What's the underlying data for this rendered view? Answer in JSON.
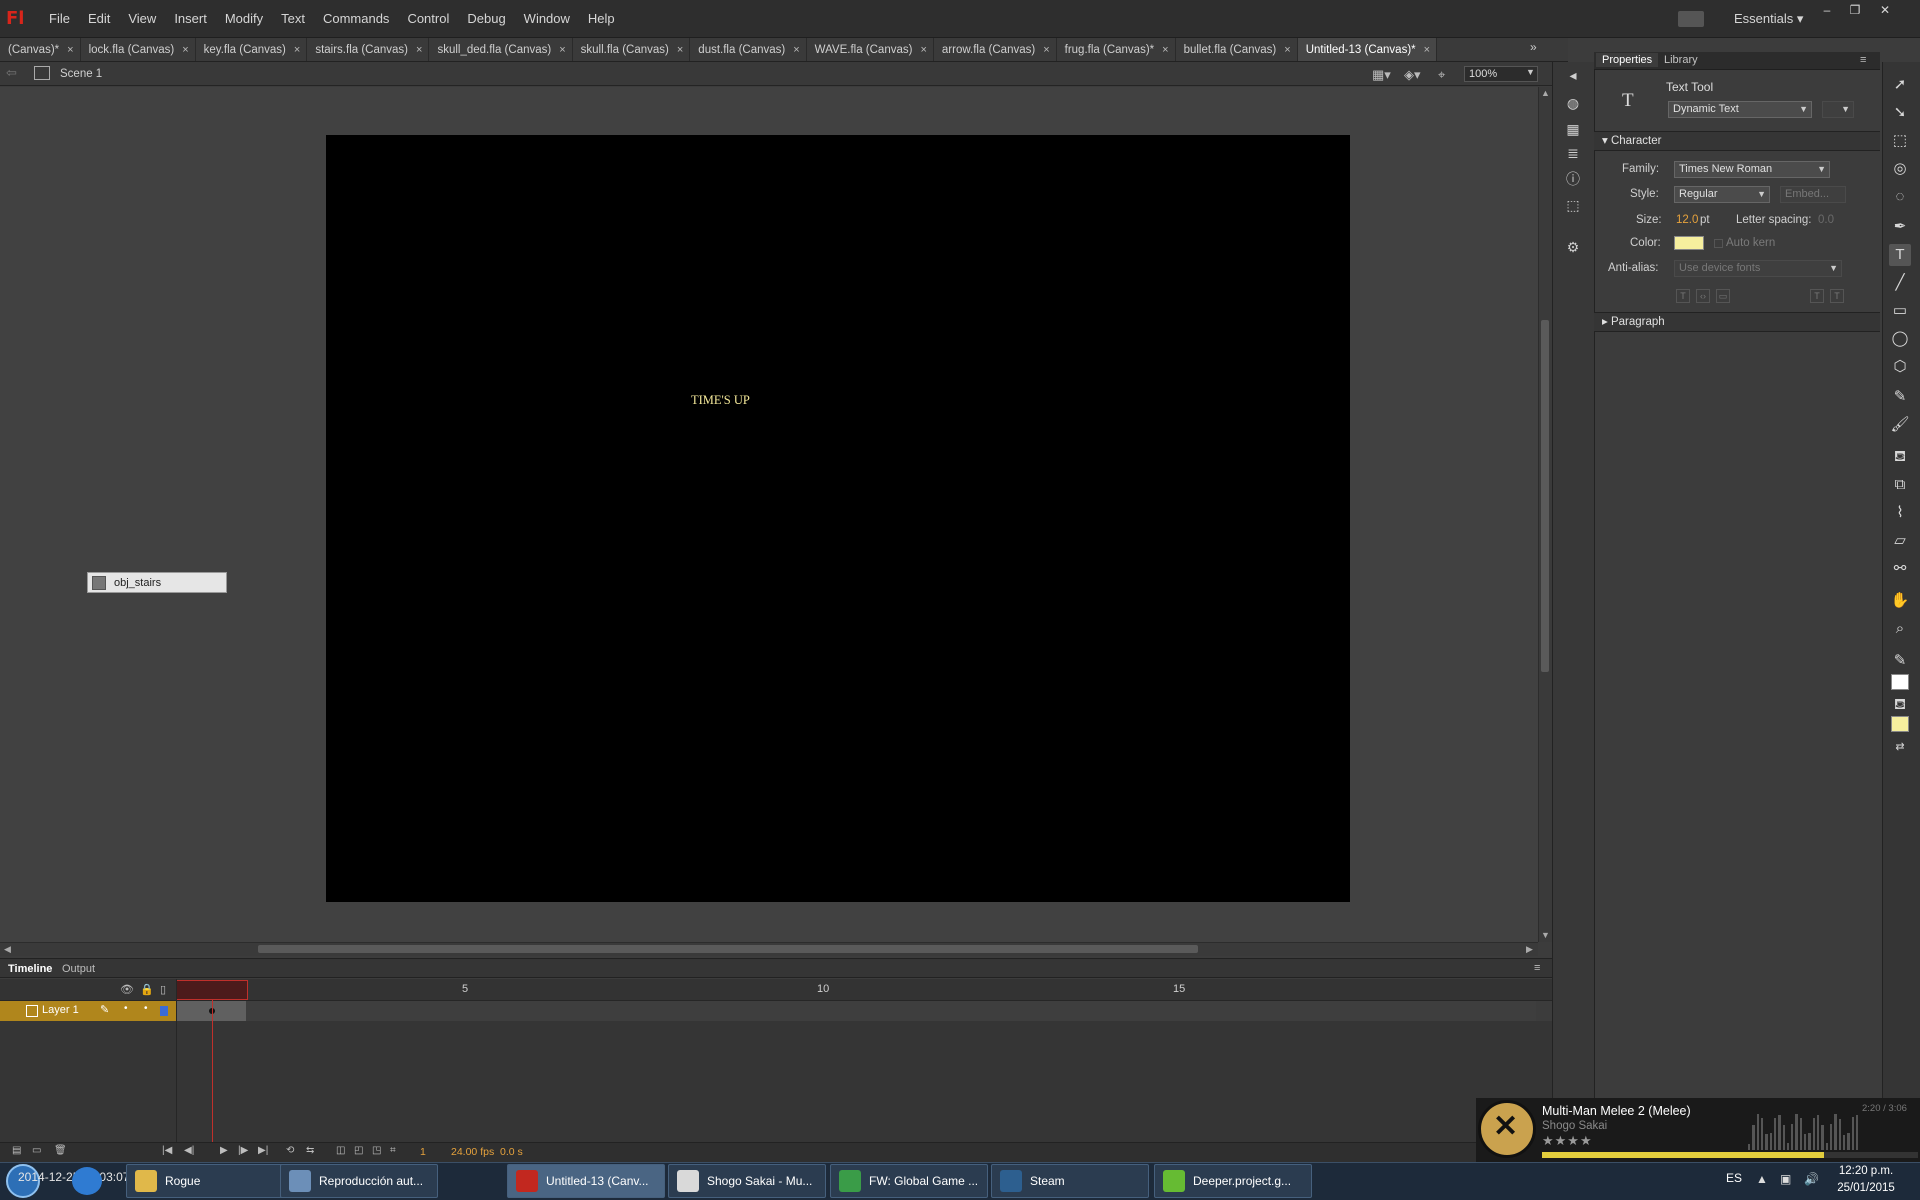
{
  "app": {
    "logo": "Fl",
    "menus": [
      "File",
      "Edit",
      "View",
      "Insert",
      "Modify",
      "Text",
      "Commands",
      "Control",
      "Debug",
      "Window",
      "Help"
    ],
    "workspace": "Essentials",
    "window_controls": [
      "–",
      "❐",
      "✕"
    ]
  },
  "doc_tabs": [
    {
      "label": "(Canvas)*",
      "active": false
    },
    {
      "label": "lock.fla (Canvas)",
      "active": false
    },
    {
      "label": "key.fla (Canvas)",
      "active": false
    },
    {
      "label": "stairs.fla (Canvas)",
      "active": false
    },
    {
      "label": "skull_ded.fla (Canvas)",
      "active": false
    },
    {
      "label": "skull.fla (Canvas)",
      "active": false
    },
    {
      "label": "dust.fla (Canvas)",
      "active": false
    },
    {
      "label": "WAVE.fla (Canvas)",
      "active": false
    },
    {
      "label": "arrow.fla (Canvas)",
      "active": false
    },
    {
      "label": "frug.fla (Canvas)*",
      "active": false
    },
    {
      "label": "bullet.fla (Canvas)",
      "active": false
    },
    {
      "label": "Untitled-13 (Canvas)*",
      "active": true
    }
  ],
  "tab_close_glyph": "×",
  "edit_bar": {
    "scene": "Scene 1",
    "zoom": "100%"
  },
  "stage": {
    "text": "TIME'S UP",
    "text_color": "#f5e99a",
    "background": "#000000"
  },
  "pasteboard_object": {
    "label": "obj_stairs"
  },
  "timeline": {
    "tabs": [
      "Timeline",
      "Output"
    ],
    "active_tab": "Timeline",
    "ruler": [
      "1",
      "5",
      "10",
      "15"
    ],
    "layer": "Layer 1",
    "current_frame": "1",
    "fps": "24.00 fps",
    "elapsed": "0.0 s"
  },
  "properties": {
    "tabs": [
      "Properties",
      "Library"
    ],
    "active_tab": "Properties",
    "tool_name": "Text Tool",
    "text_type": "Dynamic Text",
    "character_section": "Character",
    "family_label": "Family:",
    "family": "Times New Roman",
    "style_label": "Style:",
    "style": "Regular",
    "embed": "Embed...",
    "size_label": "Size:",
    "size_value": "12.0",
    "size_unit": "pt",
    "letter_spacing_label": "Letter spacing:",
    "letter_spacing": "0.0",
    "color_label": "Color:",
    "color": "#f6ef9e",
    "auto_kern": "Auto kern",
    "anti_alias_label": "Anti-alias:",
    "anti_alias": "Use device fonts",
    "paragraph_section": "Paragraph"
  },
  "tools": {
    "stroke_color": "#ffffff",
    "fill_color": "#f6ef9e"
  },
  "taskbar": {
    "ghost_text": "2014-12-25 20:03:07",
    "buttons": [
      {
        "label": "Rogue",
        "icon_color": "#e0b84a",
        "active": false
      },
      {
        "label": "Reproducción aut...",
        "icon_color": "#6c8fb8",
        "active": false
      },
      {
        "label": "Untitled-13 (Canv...",
        "icon_color": "#c2281f",
        "active": true
      },
      {
        "label": "Shogo Sakai - Mu...",
        "icon_color": "#d9d9d9",
        "active": false
      },
      {
        "label": "FW: Global Game ...",
        "icon_color": "#3a9c48",
        "active": false
      },
      {
        "label": "Steam",
        "icon_color": "#2d5f8f",
        "active": false
      },
      {
        "label": "Deeper.project.g...",
        "icon_color": "#66bb33",
        "active": false
      }
    ],
    "language": "ES",
    "time": "12:20 p.m.",
    "date": "25/01/2015"
  },
  "music": {
    "title": "Multi-Man Melee 2 (Melee)",
    "artist": "Shogo Sakai",
    "rating_glyphs": "★★★★",
    "time": "2:20 / 3:06",
    "progress": 0.75
  }
}
